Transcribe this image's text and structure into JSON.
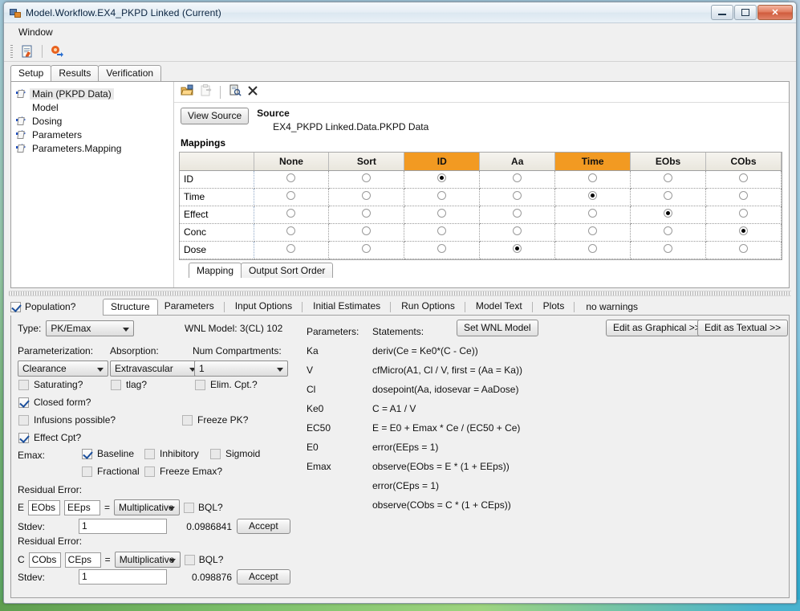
{
  "window": {
    "title": "Model.Workflow.EX4_PKPD Linked (Current)",
    "icon": "app-icon",
    "minimize": "–",
    "maximize": "□",
    "close": "✕"
  },
  "menubar": {
    "items": [
      "Window"
    ]
  },
  "toolbar": {
    "icons": [
      "edit-document-icon",
      "run-export-icon"
    ]
  },
  "top_tabs": {
    "items": [
      {
        "label": "Setup",
        "selected": true
      },
      {
        "label": "Results",
        "selected": false
      },
      {
        "label": "Verification",
        "selected": false
      }
    ]
  },
  "tree": {
    "items": [
      {
        "label": "Main (PKPD Data)",
        "icon": "link-arrow-icon",
        "selected": true,
        "indent": false
      },
      {
        "label": "Model",
        "icon": "none",
        "selected": false,
        "indent": true
      },
      {
        "label": "Dosing",
        "icon": "link-arrow-icon",
        "selected": false,
        "indent": false
      },
      {
        "label": "Parameters",
        "icon": "link-arrow-icon",
        "selected": false,
        "indent": false
      },
      {
        "label": "Parameters.Mapping",
        "icon": "link-arrow-icon",
        "selected": false,
        "indent": false
      }
    ]
  },
  "source_panel": {
    "toolbar_icons": [
      "open-folder-icon",
      "paste-icon",
      "properties-icon",
      "close-icon"
    ],
    "view_source_button": "View Source",
    "source_label": "Source",
    "source_path": "EX4_PKPD Linked.Data.PKPD Data",
    "mappings_title": "Mappings"
  },
  "mappings": {
    "columns": [
      "None",
      "Sort",
      "ID",
      "Aa",
      "Time",
      "EObs",
      "CObs"
    ],
    "highlighted_columns": [
      "ID",
      "Time"
    ],
    "highlight_color": "#f29a22",
    "rows": [
      {
        "label": "ID",
        "selected": "ID"
      },
      {
        "label": "Time",
        "selected": "Time"
      },
      {
        "label": "Effect",
        "selected": "EObs"
      },
      {
        "label": "Conc",
        "selected": "CObs"
      },
      {
        "label": "Dose",
        "selected": "Aa"
      }
    ],
    "bottom_tabs": [
      {
        "label": "Mapping",
        "selected": true
      },
      {
        "label": "Output Sort Order",
        "selected": false
      }
    ]
  },
  "model_panel": {
    "population_label": "Population?",
    "population_checked": true,
    "tabs": [
      {
        "label": "Structure",
        "selected": true
      },
      {
        "label": "Parameters",
        "selected": false
      },
      {
        "label": "Input Options",
        "selected": false
      },
      {
        "label": "Initial Estimates",
        "selected": false
      },
      {
        "label": "Run Options",
        "selected": false
      },
      {
        "label": "Model Text",
        "selected": false
      },
      {
        "label": "Plots",
        "selected": false
      }
    ],
    "warnings": "no warnings",
    "type_label": "Type:",
    "type_value": "PK/Emax",
    "wnl_model": "WNL Model: 3(CL) 102",
    "set_wnl_button": "Set WNL Model",
    "edit_graphical_button": "Edit as Graphical >>",
    "edit_textual_button": "Edit as Textual >>",
    "parameterization_label": "Parameterization:",
    "parameterization_value": "Clearance",
    "absorption_label": "Absorption:",
    "absorption_value": "Extravascular",
    "num_compartments_label": "Num Compartments:",
    "num_compartments_value": "1",
    "checks": [
      {
        "label": "Saturating?",
        "checked": false
      },
      {
        "label": "tlag?",
        "checked": false
      },
      {
        "label": "Elim. Cpt.?",
        "checked": false
      },
      {
        "label": "Closed form?",
        "checked": true
      },
      {
        "label": "Infusions possible?",
        "checked": false
      },
      {
        "label": "Freeze PK?",
        "checked": false
      },
      {
        "label": "Effect Cpt?",
        "checked": true
      }
    ],
    "emax_label": "Emax:",
    "emax_checks": [
      {
        "label": "Baseline",
        "checked": true
      },
      {
        "label": "Inhibitory",
        "checked": false
      },
      {
        "label": "Sigmoid",
        "checked": false
      },
      {
        "label": "Fractional",
        "checked": false
      },
      {
        "label": "Freeze Emax?",
        "checked": false
      }
    ],
    "parameters_header": "Parameters:",
    "parameters": [
      "Ka",
      "V",
      "Cl",
      "Ke0",
      "EC50",
      "E0",
      "Emax"
    ],
    "statements_header": "Statements:",
    "statements": [
      "deriv(Ce = Ke0*(C - Ce))",
      "cfMicro(A1, Cl / V, first = (Aa = Ka))",
      "dosepoint(Aa, idosevar = AaDose)",
      "C = A1 / V",
      "E = E0 + Emax * Ce / (EC50 + Ce)",
      "error(EEps = 1)",
      "observe(EObs = E * (1 + EEps))",
      "error(CEps = 1)",
      "observe(CObs = C * (1 + CEps))"
    ],
    "residual_errors": [
      {
        "section_label": "Residual Error:",
        "prefix": "E",
        "obs": "EObs",
        "eps": "EEps",
        "equals": "=",
        "mode": "Multiplicative",
        "bql_label": "BQL?",
        "bql_checked": false,
        "stdev_label": "Stdev:",
        "stdev_value": "1",
        "stdev_computed": "0.0986841",
        "accept_button": "Accept"
      },
      {
        "section_label": "Residual Error:",
        "prefix": "C",
        "obs": "CObs",
        "eps": "CEps",
        "equals": "=",
        "mode": "Multiplicative",
        "bql_label": "BQL?",
        "bql_checked": false,
        "stdev_label": "Stdev:",
        "stdev_value": "1",
        "stdev_computed": "0.098876",
        "accept_button": "Accept"
      }
    ]
  }
}
